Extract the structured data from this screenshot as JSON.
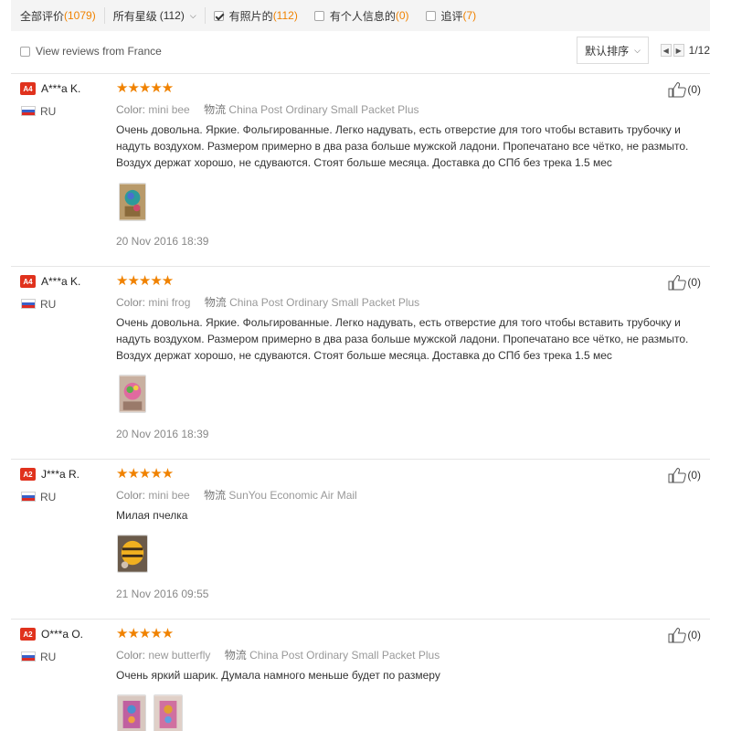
{
  "filters": {
    "all_label": "全部评价",
    "all_count": "(1079)",
    "stars_label": "所有星级",
    "stars_count": "(112)",
    "photos_label": "有照片的",
    "photos_count": "(112)",
    "photos_checked": true,
    "personal_label": "有个人信息的",
    "personal_count": "(0)",
    "followup_label": "追评",
    "followup_count": "(7)"
  },
  "subbar": {
    "france_label": "View reviews from France",
    "sort_label": "默认排序",
    "page": "1/12"
  },
  "reviews": [
    {
      "badge": "A4",
      "user": "A***a K.",
      "country": "RU",
      "stars": "★★★★★",
      "rating": 5,
      "likes": "(0)",
      "color_label": "Color:",
      "color_value": "mini bee",
      "shipping_label": "物流",
      "shipping_value": "China Post Ordinary Small Packet Plus",
      "text": "Очень довольна. Яркие. Фольгированные. Легко надувать, есть отверстие для того чтобы вставить трубочку и надуть воздухом. Размером примерно в два раза больше мужской ладони. Пропечатано все чётко, не размыто. Воздух держат хорошо, не сдуваются. Стоят больше месяца. Доставка до СПб без трека 1.5 мес",
      "date": "20 Nov 2016 18:39"
    },
    {
      "badge": "A4",
      "user": "A***a K.",
      "country": "RU",
      "stars": "★★★★★",
      "rating": 5,
      "likes": "(0)",
      "color_label": "Color:",
      "color_value": "mini frog",
      "shipping_label": "物流",
      "shipping_value": "China Post Ordinary Small Packet Plus",
      "text": "Очень довольна. Яркие. Фольгированные. Легко надувать, есть отверстие для того чтобы вставить трубочку и надуть воздухом. Размером примерно в два раза больше мужской ладони. Пропечатано все чётко, не размыто. Воздух держат хорошо, не сдуваются. Стоят больше месяца. Доставка до СПб без трека 1.5 мес",
      "date": "20 Nov 2016 18:39"
    },
    {
      "badge": "A2",
      "user": "J***a R.",
      "country": "RU",
      "stars": "★★★★★",
      "rating": 5,
      "likes": "(0)",
      "color_label": "Color:",
      "color_value": "mini bee",
      "shipping_label": "物流",
      "shipping_value": "SunYou Economic Air Mail",
      "text": "Милая пчелка",
      "date": "21 Nov 2016 09:55"
    },
    {
      "badge": "A2",
      "user": "O***a O.",
      "country": "RU",
      "stars": "★★★★★",
      "rating": 5,
      "likes": "(0)",
      "color_label": "Color:",
      "color_value": "new butterfly",
      "shipping_label": "物流",
      "shipping_value": "China Post Ordinary Small Packet Plus",
      "text": "Очень яркий шарик. Думала намного меньше будет по размеру",
      "date": ""
    }
  ]
}
